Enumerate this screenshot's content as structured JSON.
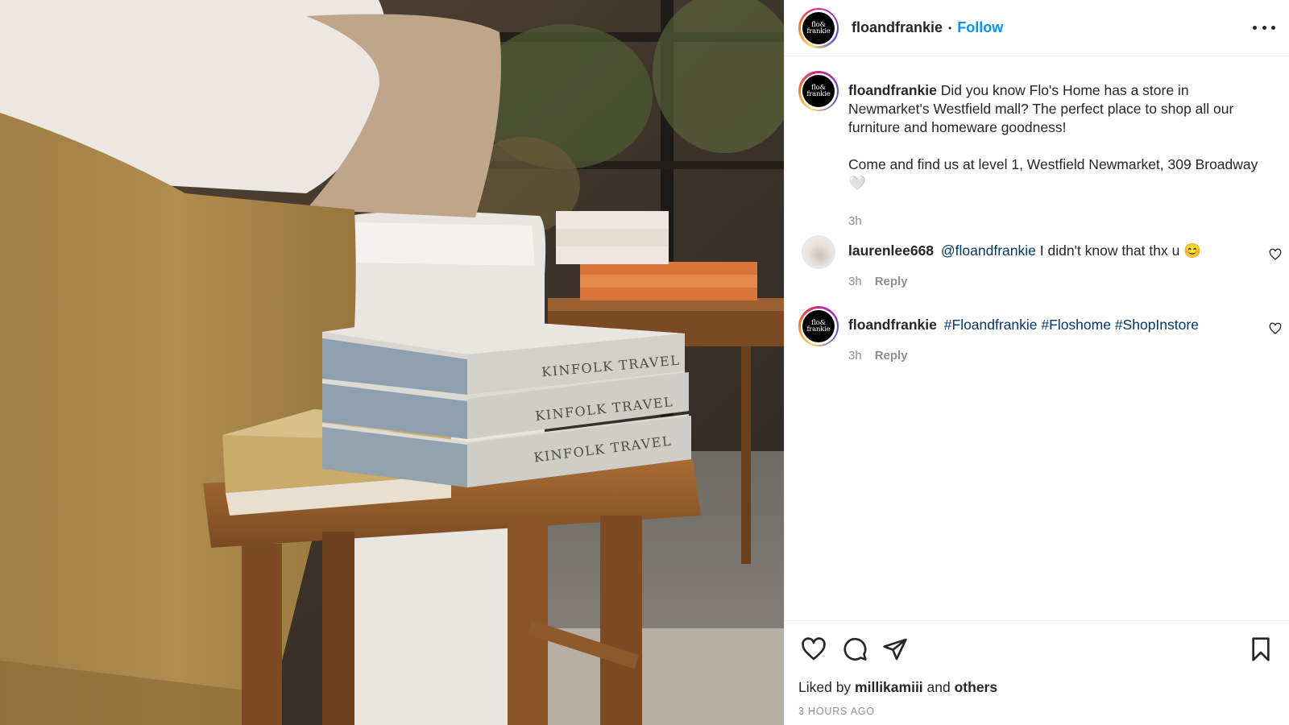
{
  "post": {
    "username": "floandfrankie",
    "follow_label": "Follow",
    "separator": "•",
    "avatar_text_line1": "flo&",
    "avatar_text_line2": "frankie"
  },
  "photo": {
    "book_spine_1": "KINFOLK TRAVEL",
    "book_spine_2": "KINFOLK TRAVEL",
    "book_spine_3": "KINFOLK TRAVEL"
  },
  "caption": {
    "username": "floandfrankie",
    "text_line1": "Did you know Flo's Home has a store in Newmarket's Westfield mall? The perfect place to shop all our furniture and homeware goodness!",
    "text_line2": "Come and find us at level 1, Westfield Newmarket, 309 Broadway 🤍",
    "time": "3h"
  },
  "comments": [
    {
      "username": "laurenlee668",
      "mention": "@floandfrankie",
      "text": " I didn't know that thx u 😊",
      "time": "3h",
      "reply_label": "Reply"
    },
    {
      "username": "floandfrankie",
      "tags": "#Floandfrankie #Floshome #ShopInstore",
      "time": "3h",
      "reply_label": "Reply"
    }
  ],
  "footer": {
    "liked_by_prefix": "Liked by ",
    "liked_by_user": "millikamiii",
    "liked_by_and": " and ",
    "liked_by_others": "others",
    "post_age": "3 HOURS AGO"
  },
  "colors": {
    "link_blue": "#0095f6",
    "mention_blue": "#00376b",
    "secondary_text": "#8e8e8e"
  }
}
